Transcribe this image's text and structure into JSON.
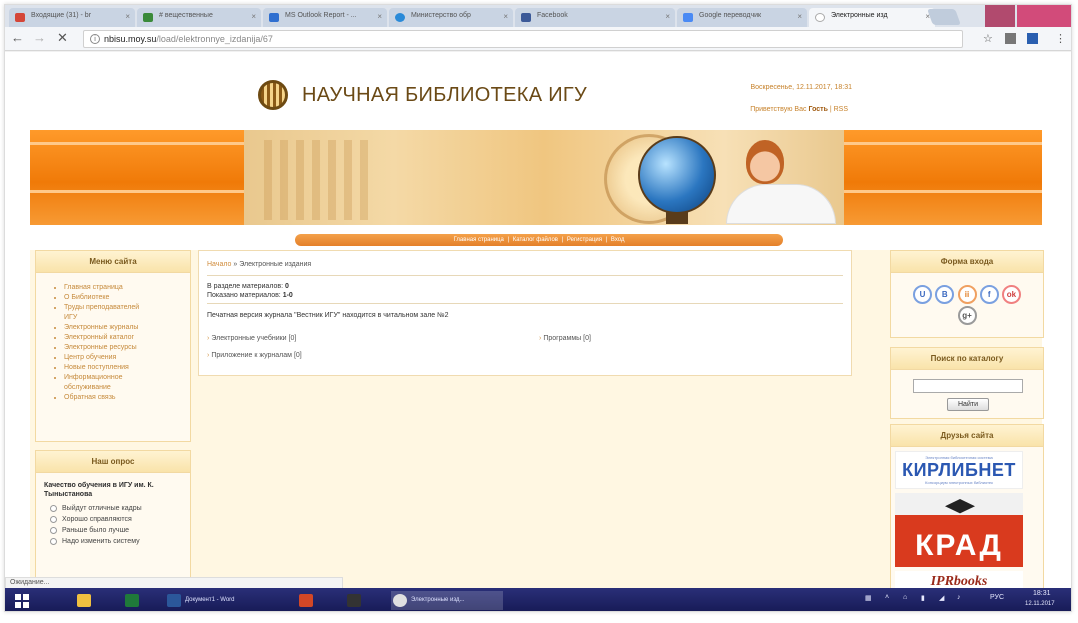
{
  "browser": {
    "tabs": [
      {
        "label": "Входящие (31) - br",
        "color": "#d44638"
      },
      {
        "label": "# вещественные",
        "color": "#3a8a3a"
      },
      {
        "label": "MS Outlook Report - ...",
        "color": "#2f6fd0"
      },
      {
        "label": "Министерство обр",
        "color": "#2a8ad8"
      },
      {
        "label": "Facebook",
        "color": "#3b5998"
      },
      {
        "label": "Google переводчик",
        "color": "#4a8af4"
      },
      {
        "label": "Электронные изд",
        "color": "#8a8a8a"
      }
    ],
    "tab_close": "×",
    "url_host": "nbisu.moy.su",
    "url_path": "/load/elektronnye_izdanija/67",
    "back_icon": "←",
    "forward_icon": "→",
    "reload_icon": "✕",
    "star_icon": "☆"
  },
  "site": {
    "title": "НАУЧНАЯ БИБЛИОТЕКА ИГУ",
    "date": "Воскресенье, 12.11.2017, 18:31",
    "greeting_prefix": "Приветствую Вас ",
    "greeting_name": "Гость",
    "greeting_suffix": " | RSS"
  },
  "topnav": {
    "items": [
      "Главная страница",
      "Каталог файлов",
      "Регистрация",
      "Вход"
    ],
    "sep": "|"
  },
  "left_menu": {
    "title": "Меню сайта",
    "items": [
      "Главная страница",
      "О Библиотеке",
      "Труды преподавателей",
      "ИГУ",
      "Электронные журналы",
      "Электронный каталог",
      "Электронные ресурсы",
      "Центр обучения",
      "Новые поступления",
      "Информационное",
      "обслуживание",
      "Обратная связь"
    ]
  },
  "poll": {
    "title": "Наш опрос",
    "question": "Качество обучения в ИГУ им. К. Тыныстанова",
    "options": [
      "Выйдут отличные кадры",
      "Хорошо справляются",
      "Раньше было лучше",
      "Надо изменить систему"
    ]
  },
  "content": {
    "crumb_home": "Начало",
    "crumb_sep": " » ",
    "crumb_current": "Электронные издания",
    "in_section": "В разделе материалов: ",
    "in_section_value": "0",
    "shown": "Показано материалов: ",
    "shown_value": "1-0",
    "note": "Печатная версия журнала \"Вестник ИГУ\" находится в читальном зале №2",
    "categories": [
      {
        "label": "Электронные учебники",
        "count": "[0]"
      },
      {
        "label": "Программы",
        "count": "[0]"
      },
      {
        "label": "Приложение к журналам",
        "count": "[0]"
      }
    ],
    "arrow": "›"
  },
  "right": {
    "login_title": "Форма входа",
    "social": [
      "U",
      "B",
      "ii",
      "f",
      "ok",
      "g+"
    ],
    "search_title": "Поиск по каталогу",
    "search_button": "Найти",
    "friends_title": "Друзья сайта",
    "kirlib_small": "Электронная библиотечная система",
    "kirlib_big": "КИРЛИБНЕТ",
    "kirlib_small2": "Консорциум электронных библиотек",
    "krad": "КРАД",
    "ipr": "IPRbooks"
  },
  "status_text": "Ожидание...",
  "taskbar": {
    "tasks": [
      {
        "label": "",
        "color": "#f0c040"
      },
      {
        "label": "",
        "color": "#1f7a3a"
      },
      {
        "label": "Документ1 - Word",
        "color": "#2b579a"
      },
      {
        "label": "",
        "color": "#d24726"
      },
      {
        "label": "",
        "color": "#333333"
      },
      {
        "label": "Электронные изд...",
        "color": "#e0e0e0"
      }
    ],
    "lang": "РУС",
    "time": "18:31",
    "date": "12.11.2017"
  }
}
